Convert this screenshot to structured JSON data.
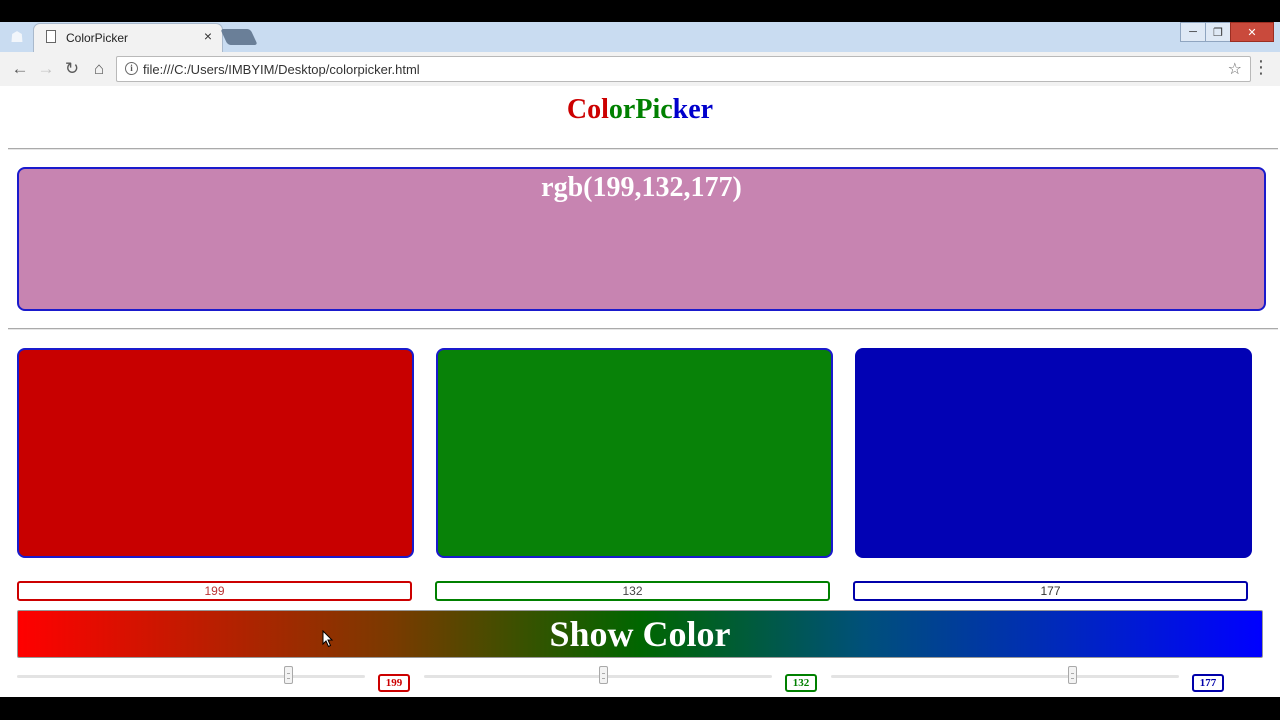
{
  "browser": {
    "tab_title": "ColorPicker",
    "close_tab_glyph": "×",
    "url": "file:///C:/Users/IMBYIM/Desktop/colorpicker.html",
    "icons": {
      "back": "←",
      "forward": "→",
      "reload": "↻",
      "home": "⌂",
      "star": "☆",
      "menu": "⋮",
      "info": "i",
      "profile": "☗",
      "minimize": "─",
      "restore": "❐",
      "close": "✕"
    }
  },
  "heading": {
    "parts": [
      {
        "text": "C",
        "color": "#cc0000"
      },
      {
        "text": "o",
        "color": "#cc0000"
      },
      {
        "text": "l",
        "color": "#cc0000"
      },
      {
        "text": "o",
        "color": "#008000"
      },
      {
        "text": "r",
        "color": "#008000"
      },
      {
        "text": "P",
        "color": "#008000"
      },
      {
        "text": "i",
        "color": "#008000"
      },
      {
        "text": "c",
        "color": "#008000"
      },
      {
        "text": "k",
        "color": "#0000cc"
      },
      {
        "text": "e",
        "color": "#0000cc"
      },
      {
        "text": "r",
        "color": "#0000cc"
      }
    ]
  },
  "preview": {
    "label": "rgb(199,132,177)",
    "color": "#c784b1"
  },
  "channels": [
    {
      "name": "red",
      "swatch_color": "#c80000",
      "accent": "#cc0000",
      "value": 199,
      "value_text": "199",
      "box_text_color": "#b33"
    },
    {
      "name": "green",
      "swatch_color": "#088208",
      "accent": "#008000",
      "value": 132,
      "value_text": "132",
      "box_text_color": "#444"
    },
    {
      "name": "blue",
      "swatch_color": "#0202b4",
      "accent": "#0000aa",
      "value": 177,
      "value_text": "177",
      "box_text_color": "#333"
    }
  ],
  "slider_max": 255,
  "show_color_button": "Show Color"
}
